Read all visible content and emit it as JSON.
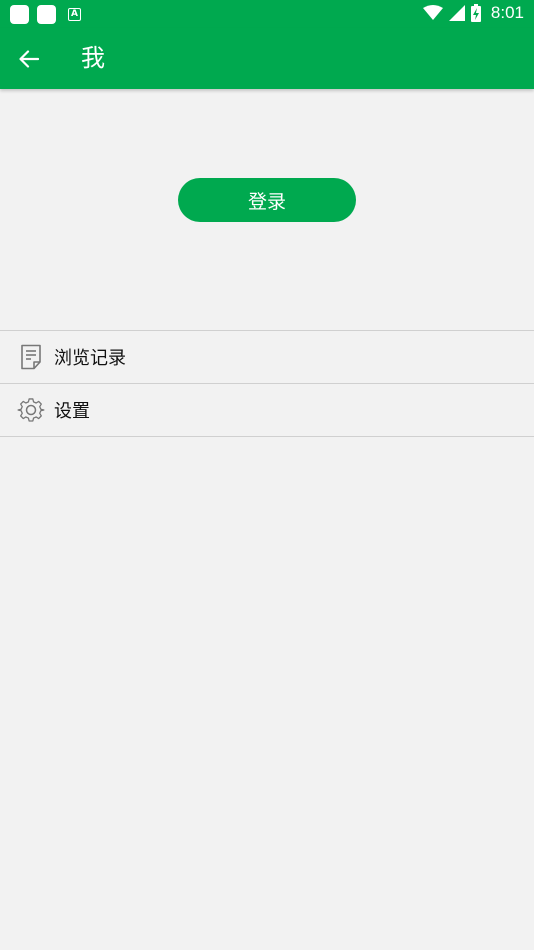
{
  "status_bar": {
    "time": "8:01",
    "icons": [
      "notification-square-icon",
      "notification-square-icon",
      "keyboard-a-icon",
      "wifi-icon",
      "signal-icon",
      "battery-charging-icon"
    ]
  },
  "app_bar": {
    "title": "我",
    "back_icon": "arrow-left-icon"
  },
  "login": {
    "label": "登录"
  },
  "menu": {
    "items": [
      {
        "label": "浏览记录",
        "icon": "history-document-icon"
      },
      {
        "label": "设置",
        "icon": "gear-icon"
      }
    ]
  },
  "colors": {
    "primary": "#00a94f",
    "background": "#f2f2f2",
    "divider": "#d0d0d0"
  }
}
